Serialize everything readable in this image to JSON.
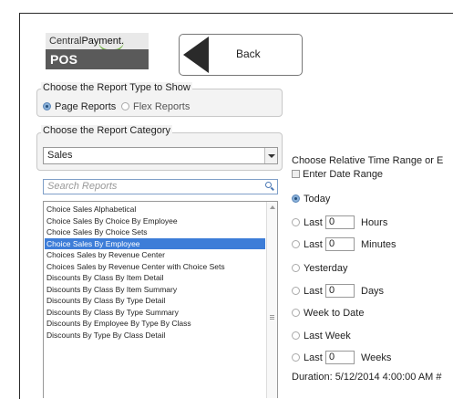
{
  "logo": {
    "brand_prefix": "Central",
    "brand_suffix": "Payment.",
    "product": "POS SOLUTIONS"
  },
  "back_button": {
    "label": "Back"
  },
  "report_type": {
    "legend": "Choose the Report Type to Show",
    "options": [
      {
        "label": "Page Reports",
        "selected": true
      },
      {
        "label": "Flex Reports",
        "selected": false
      }
    ]
  },
  "report_category": {
    "legend": "Choose the Report Category",
    "selected_value": "Sales"
  },
  "search": {
    "placeholder": "Search Reports"
  },
  "reports_list": {
    "items": [
      "Choice Sales Alphabetical",
      "Choice Sales By Choice By Employee",
      "Choice Sales By Choice Sets",
      "Choice Sales By Employee",
      "Choices Sales by Revenue Center",
      "Choices Sales by Revenue Center with Choice Sets",
      "Discounts By Class By Item Detail",
      "Discounts By Class By Item Summary",
      "Discounts By Class By Type Detail",
      "Discounts By Class By Type Summary",
      "Discounts By Employee By Type By Class",
      "Discounts By Type By Class Detail"
    ],
    "selected_index": 3
  },
  "time_range": {
    "heading": "Choose Relative Time Range or E",
    "enter_date_range_label": "Enter Date Range",
    "options": {
      "today": "Today",
      "last_hours": {
        "label": "Last",
        "value": "0",
        "unit": "Hours"
      },
      "last_minutes": {
        "label": "Last",
        "value": "0",
        "unit": "Minutes"
      },
      "yesterday": "Yesterday",
      "last_days": {
        "label": "Last",
        "value": "0",
        "unit": "Days"
      },
      "week_to_date": "Week to Date",
      "last_week": "Last Week",
      "last_weeks": {
        "label": "Last",
        "value": "0",
        "unit": "Weeks"
      }
    },
    "selected": "today",
    "duration_text": "Duration: 5/12/2014 4:00:00 AM #"
  },
  "colors": {
    "selection": "#3d7dd8",
    "logo_dark": "#5a5a5a",
    "logo_accent": "#6fb43f"
  }
}
